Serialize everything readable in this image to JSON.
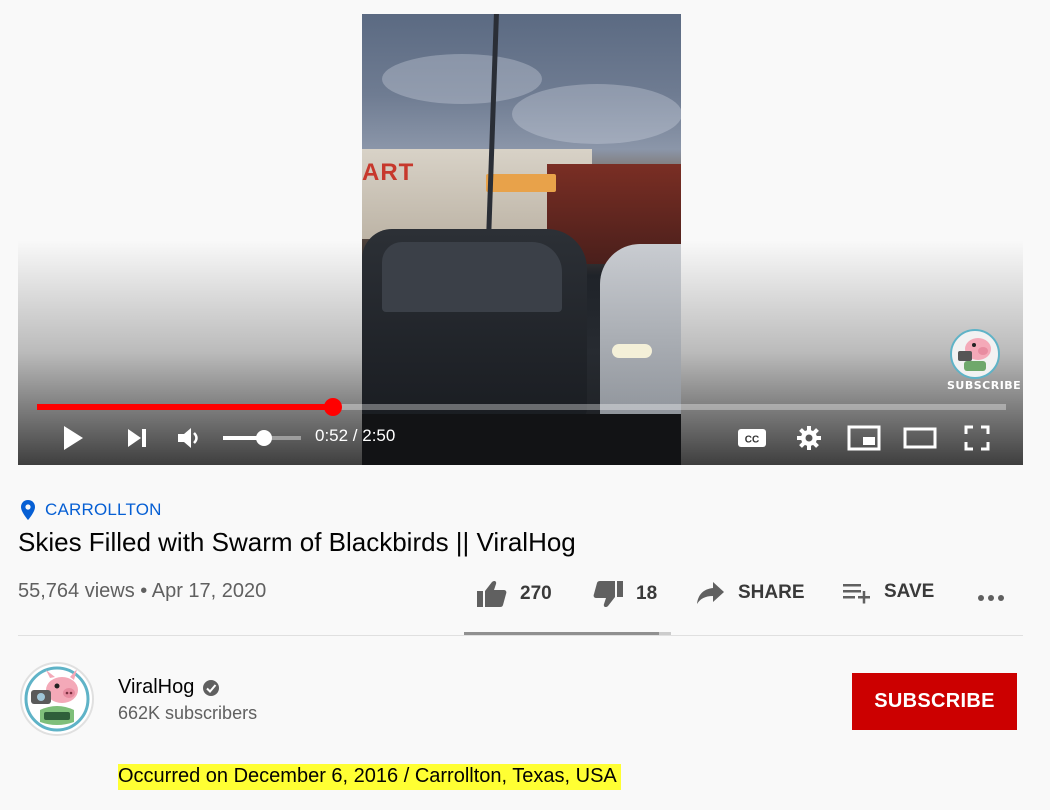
{
  "player": {
    "watermark_label": "SUBSCRIBE",
    "progress_fraction": 0.305,
    "volume_fraction": 0.52,
    "current_time": "0:52",
    "duration": "2:50",
    "time_display": "0:52 / 2:50",
    "controls": [
      "play-icon",
      "next-icon",
      "volume-icon",
      "captions-icon",
      "settings-icon",
      "miniplayer-icon",
      "theater-icon",
      "fullscreen-icon"
    ],
    "accent_color": "#ff0000",
    "frame_sign_text": "ART"
  },
  "video": {
    "location": "CARROLLTON",
    "title": "Skies Filled with Swarm of Blackbirds || ViralHog",
    "views": "55,764 views",
    "date": "Apr 17, 2020",
    "meta_text": "55,764 views • Apr 17, 2020"
  },
  "actions": {
    "likes": "270",
    "dislikes": "18",
    "share_label": "SHARE",
    "save_label": "SAVE",
    "like_ratio": 0.94
  },
  "channel": {
    "name": "ViralHog",
    "subscribers": "662K subscribers",
    "subscribe_label": "SUBSCRIBE",
    "subscribe_color": "#cc0000"
  },
  "description": {
    "text": "Occurred on December 6, 2016 / Carrollton, Texas, USA",
    "highlight_color": "#ffff33"
  }
}
